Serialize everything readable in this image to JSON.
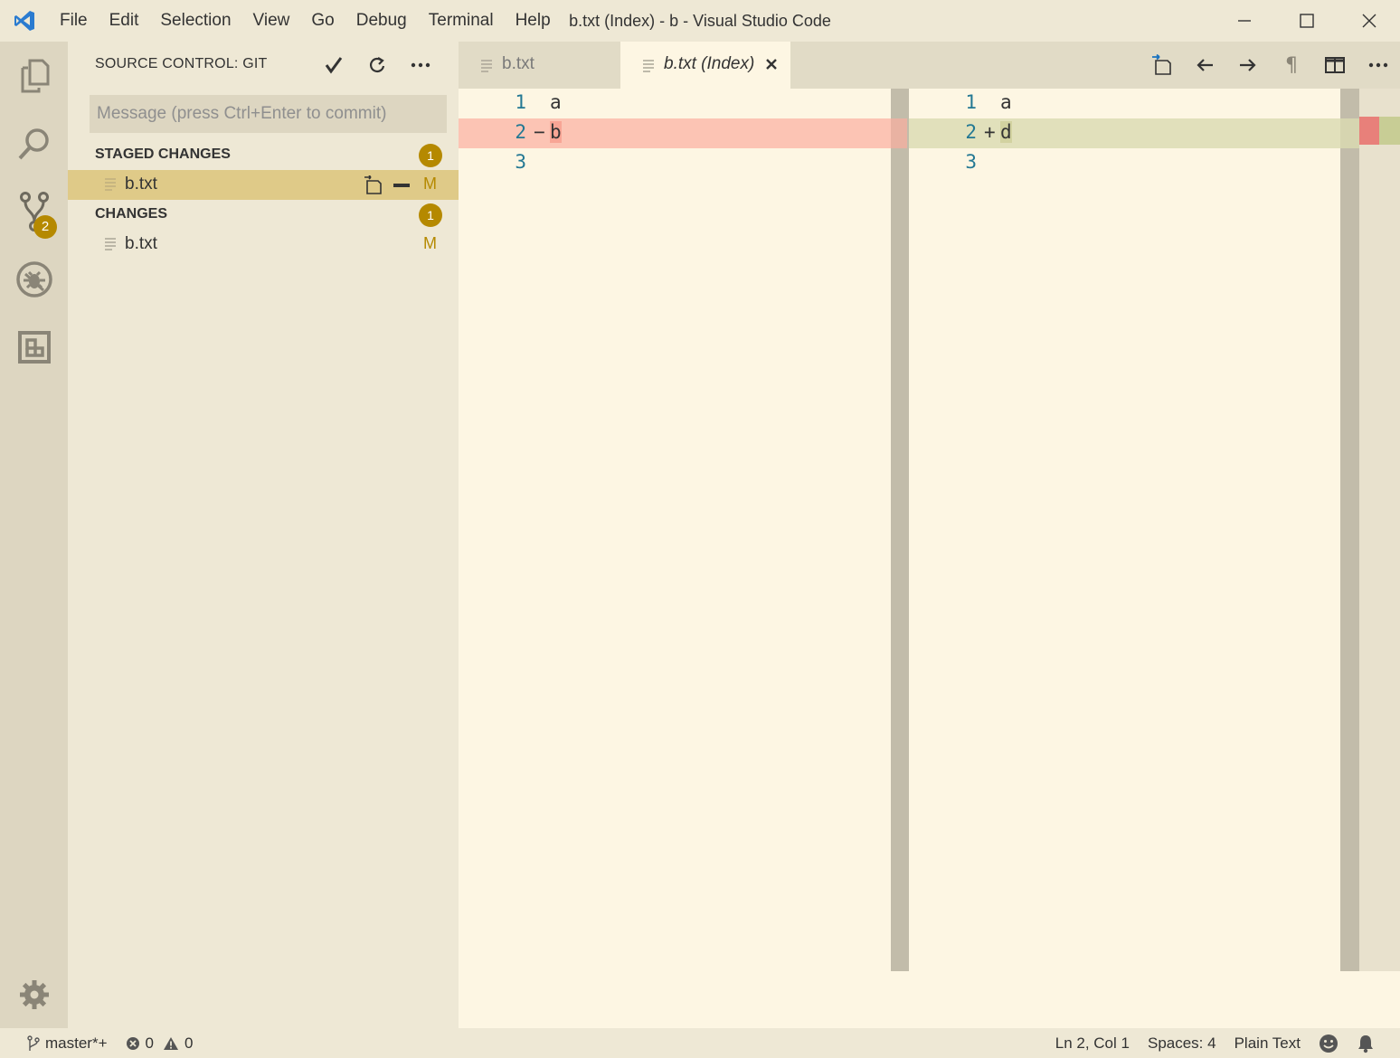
{
  "window": {
    "title": "b.txt (Index) - b - Visual Studio Code"
  },
  "menu": [
    "File",
    "Edit",
    "Selection",
    "View",
    "Go",
    "Debug",
    "Terminal",
    "Help"
  ],
  "activity_bar": {
    "items": [
      "explorer-icon",
      "search-icon",
      "source-control-icon",
      "debug-icon",
      "extensions-icon"
    ],
    "scm_badge": "2",
    "settings": "gear-icon"
  },
  "sidebar": {
    "title": "SOURCE CONTROL: GIT",
    "commit_placeholder": "Message (press Ctrl+Enter to commit)",
    "staged": {
      "label": "STAGED CHANGES",
      "count": "1",
      "files": [
        {
          "name": "b.txt",
          "status": "M"
        }
      ]
    },
    "changes": {
      "label": "CHANGES",
      "count": "1",
      "files": [
        {
          "name": "b.txt",
          "status": "M"
        }
      ]
    }
  },
  "tabs": [
    {
      "label": "b.txt",
      "active": false
    },
    {
      "label": "b.txt (Index)",
      "active": true
    }
  ],
  "diff": {
    "left": [
      {
        "n": "1",
        "marker": "",
        "text": "a",
        "kind": "normal"
      },
      {
        "n": "2",
        "marker": "−",
        "text": "b",
        "kind": "removed"
      },
      {
        "n": "3",
        "marker": "",
        "text": "",
        "kind": "normal"
      }
    ],
    "right": [
      {
        "n": "1",
        "marker": "",
        "text": "a",
        "kind": "normal"
      },
      {
        "n": "2",
        "marker": "+",
        "text": "d",
        "kind": "added"
      },
      {
        "n": "3",
        "marker": "",
        "text": "",
        "kind": "normal"
      }
    ]
  },
  "status": {
    "branch": "master*+",
    "errors": "0",
    "warnings": "0",
    "cursor": "Ln 2, Col 1",
    "spaces": "Spaces: 4",
    "language": "Plain Text"
  },
  "colors": {
    "accent": "#b58900",
    "removed": "#fcc4b4",
    "added": "#e1e0bb",
    "line_number": "#237893"
  }
}
